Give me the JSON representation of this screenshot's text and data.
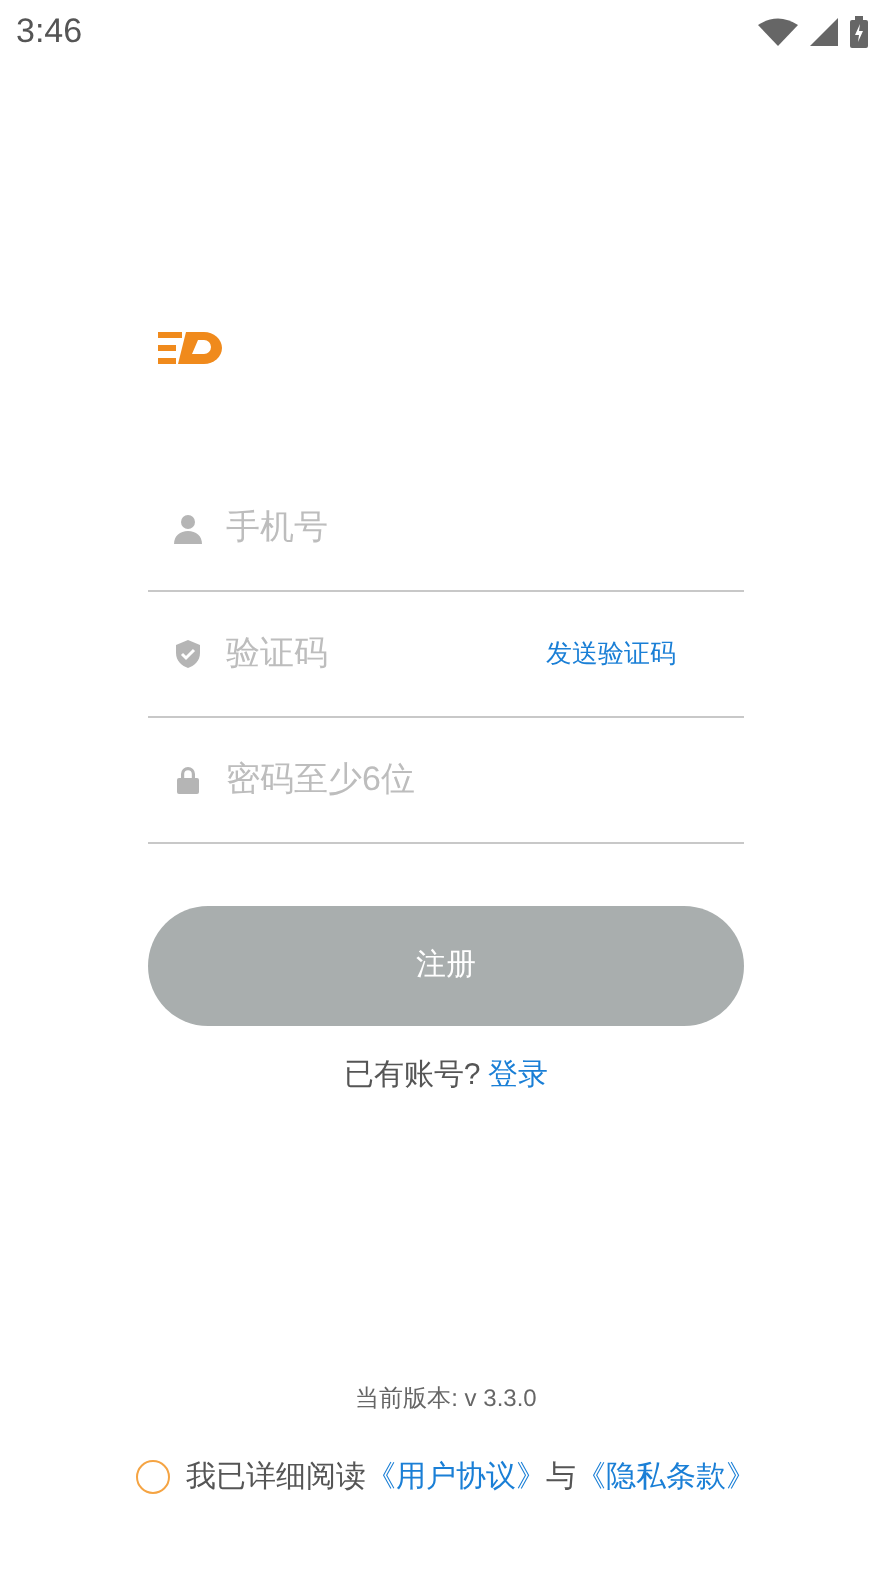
{
  "status_bar": {
    "time": "3:46"
  },
  "form": {
    "fields": [
      {
        "kind": "phone",
        "placeholder": "手机号"
      },
      {
        "kind": "code",
        "placeholder": "验证码",
        "action": "发送验证码"
      },
      {
        "kind": "password",
        "placeholder": "密码至少6位"
      }
    ]
  },
  "register_button": {
    "label": "注册",
    "disabled": true
  },
  "login_prompt": {
    "text": "已有账号?",
    "link": "登录"
  },
  "version": "当前版本: v 3.3.0",
  "agreement": {
    "checked": false,
    "text": "我已详细阅读",
    "link_1": "《用户协议》",
    "joiner": "与",
    "link_2": "《隐私条款》"
  }
}
